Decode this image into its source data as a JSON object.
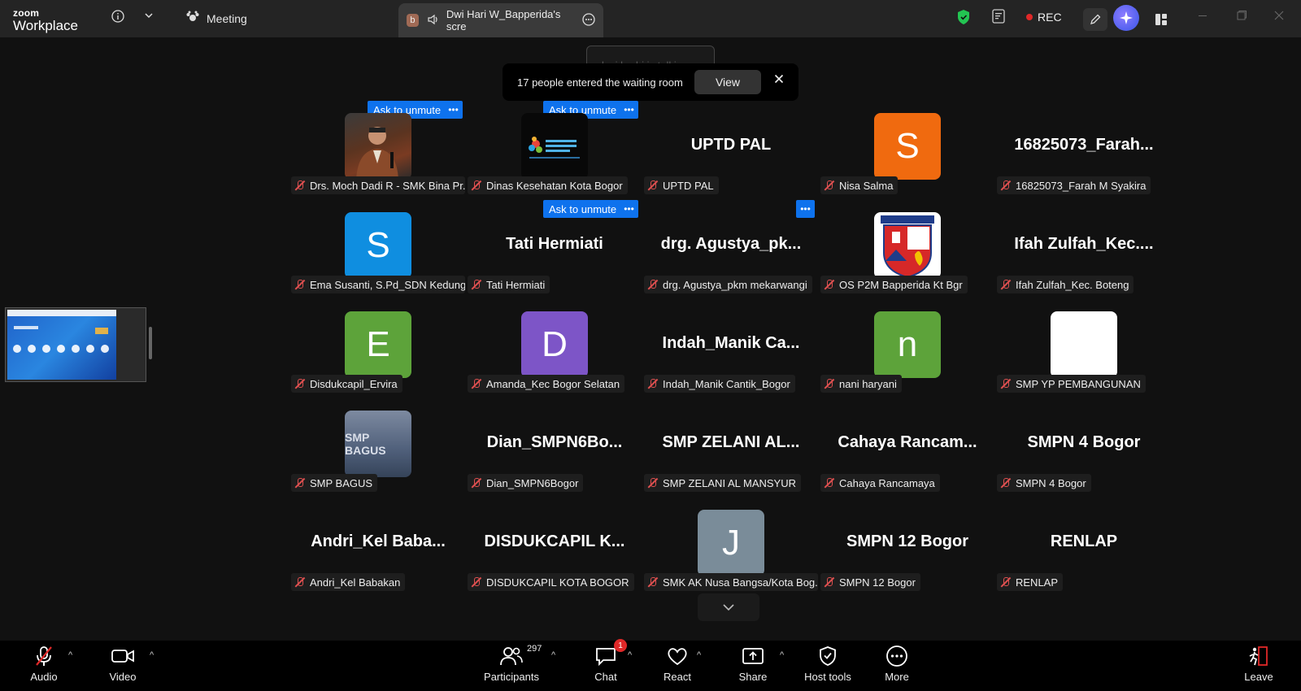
{
  "app": {
    "logo_line1": "zoom",
    "logo_line2": "Workplace"
  },
  "titlebar": {
    "meeting_label": "Meeting",
    "share_tab_badge": "b",
    "share_tab_label": "Dwi Hari W_Bapperida's scre",
    "rec_label": "REC"
  },
  "talking_indicator": "lusi badri is talking...",
  "waiting_room": {
    "message": "17 people entered the waiting room",
    "view_label": "View"
  },
  "ask_unmute_label": "Ask to unmute",
  "participants": [
    {
      "display": "photo",
      "style": "photo1",
      "name": "Drs. Moch Dadi R - SMK Bina Pr..."
    },
    {
      "display": "photo",
      "style": "photo2",
      "name": "Dinas Kesehatan Kota Bogor"
    },
    {
      "display": "text",
      "big": "UPTD PAL",
      "name": "UPTD PAL"
    },
    {
      "display": "avatar",
      "letter": "S",
      "color": "#f06a0f",
      "name": "Nisa Salma"
    },
    {
      "display": "text",
      "big": "16825073_Farah...",
      "name": "16825073_Farah M Syakira"
    },
    {
      "display": "avatar",
      "letter": "S",
      "color": "#0f8ee0",
      "name": "Ema Susanti, S.Pd_SDN Kedung..."
    },
    {
      "display": "text",
      "big": "Tati Hermiati",
      "name": "Tati Hermiati"
    },
    {
      "display": "text",
      "big": "drg.  Agustya_pk...",
      "name": "drg. Agustya_pkm mekarwangi"
    },
    {
      "display": "photo",
      "style": "photo-bogor",
      "name": "OS  P2M  Bapperida Kt Bgr"
    },
    {
      "display": "text",
      "big": "Ifah  Zulfah_Kec....",
      "name": "Ifah Zulfah_Kec. Boteng"
    },
    {
      "display": "avatar",
      "letter": "E",
      "color": "#5da33a",
      "name": "Disdukcapil_Ervira"
    },
    {
      "display": "avatar",
      "letter": "D",
      "color": "#7d55c7",
      "name": "Amanda_Kec Bogor Selatan"
    },
    {
      "display": "text",
      "big": "Indah_Manik  Ca...",
      "name": "Indah_Manik Cantik_Bogor"
    },
    {
      "display": "avatar",
      "letter": "n",
      "color": "#5da33a",
      "name": "nani haryani"
    },
    {
      "display": "avatar",
      "letter": "",
      "color": "#ffffff",
      "name": "SMP YP PEMBANGUNAN"
    },
    {
      "display": "photo",
      "style": "photo-sign",
      "name": "SMP BAGUS"
    },
    {
      "display": "text",
      "big": "Dian_SMPN6Bo...",
      "name": "Dian_SMPN6Bogor"
    },
    {
      "display": "text",
      "big": "SMP  ZELANI  AL...",
      "name": "SMP ZELANI AL MANSYUR"
    },
    {
      "display": "text",
      "big": "Cahaya  Rancam...",
      "name": "Cahaya Rancamaya"
    },
    {
      "display": "text",
      "big": "SMPN 4 Bogor",
      "name": "SMPN 4 Bogor"
    },
    {
      "display": "text",
      "big": "Andri_Kel  Baba...",
      "name": "Andri_Kel Babakan"
    },
    {
      "display": "text",
      "big": "DISDUKCAPIL  K...",
      "name": "DISDUKCAPIL KOTA BOGOR"
    },
    {
      "display": "avatar",
      "letter": "J",
      "color": "#7a8c99",
      "name": "SMK AK Nusa Bangsa/Kota Bog..."
    },
    {
      "display": "text",
      "big": "SMPN 12 Bogor",
      "name": "SMPN 12 Bogor"
    },
    {
      "display": "text",
      "big": "RENLAP",
      "name": "RENLAP"
    }
  ],
  "photo_sign_text": "SMP BAGUS",
  "toolbar": {
    "audio": "Audio",
    "video": "Video",
    "participants": "Participants",
    "participants_count": "297",
    "chat": "Chat",
    "chat_badge": "1",
    "react": "React",
    "share": "Share",
    "host_tools": "Host tools",
    "more": "More",
    "leave": "Leave"
  },
  "colors": {
    "accent_blue": "#0e72ed",
    "mute_red": "#e05050",
    "rec_red": "#e02828"
  }
}
